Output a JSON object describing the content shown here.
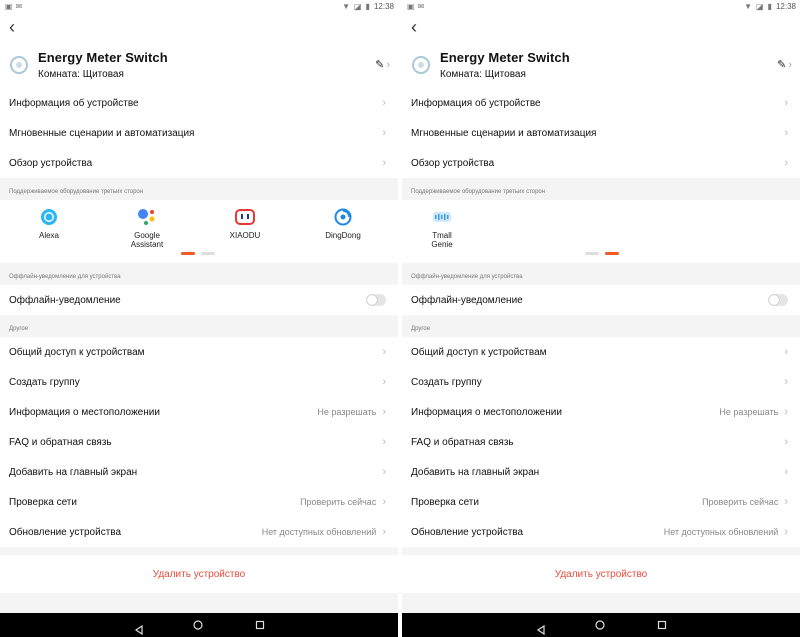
{
  "status": {
    "time": "12:38"
  },
  "device": {
    "name": "Energy Meter Switch",
    "room": "Комната: Щитовая"
  },
  "menu_top": [
    {
      "label": "Информация об устройстве"
    },
    {
      "label": "Мгновенные сценарии и автоматизация"
    },
    {
      "label": "Обзор устройства"
    }
  ],
  "third_party": {
    "header": "Поддерживаемое оборудование третьих сторон",
    "page1": [
      {
        "label": "Alexa",
        "icon": "alexa-icon"
      },
      {
        "label": "Google\nAssistant",
        "icon": "google-assistant-icon"
      },
      {
        "label": "XIAODU",
        "icon": "xiaodu-icon"
      },
      {
        "label": "DingDong",
        "icon": "dingdong-icon"
      }
    ],
    "page2": [
      {
        "label": "Tmall\nGenie",
        "icon": "tmall-genie-icon"
      }
    ]
  },
  "offline": {
    "header": "Оффлайн-уведомление для устройства",
    "label": "Оффлайн-уведомление",
    "enabled": false
  },
  "other": {
    "header": "Другое",
    "items": [
      {
        "label": "Общий доступ к устройствам",
        "value": ""
      },
      {
        "label": "Создать группу",
        "value": ""
      },
      {
        "label": "Информация о местоположении",
        "value": "Не разрешать"
      },
      {
        "label": "FAQ и обратная связь",
        "value": ""
      },
      {
        "label": "Добавить на главный экран",
        "value": ""
      },
      {
        "label": "Проверка сети",
        "value": "Проверить сейчас"
      },
      {
        "label": "Обновление устройства",
        "value": "Нет доступных обновлений"
      }
    ]
  },
  "delete_label": "Удалить устройство",
  "colors": {
    "accent": "#f05a24",
    "danger": "#e84c3d"
  }
}
